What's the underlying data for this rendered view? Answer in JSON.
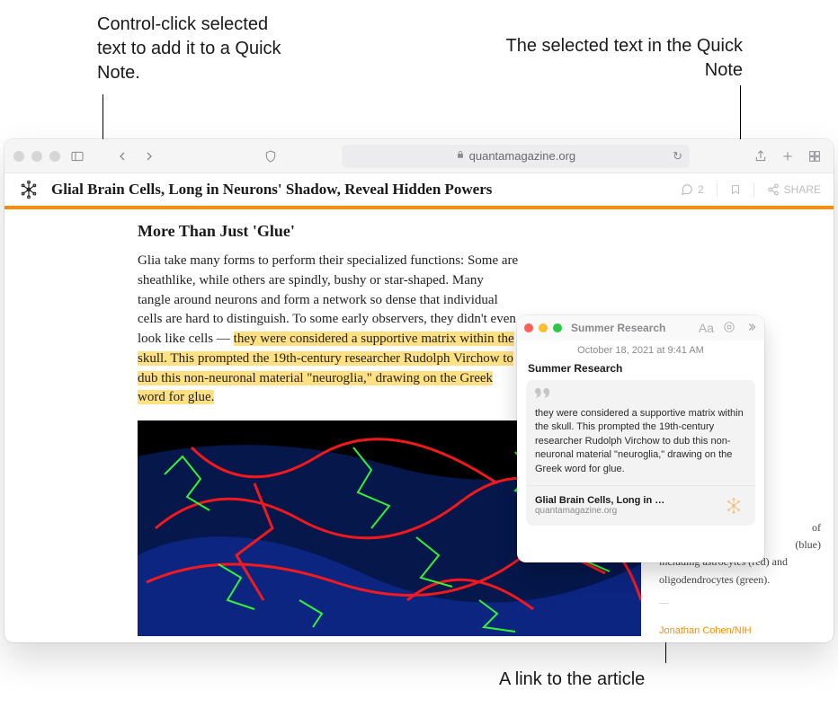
{
  "callouts": {
    "c1": "Control-click selected text to add it to a Quick Note.",
    "c2": "The selected text in the Quick Note",
    "c3": "A link to the article"
  },
  "toolbar": {
    "url_display": "quantamagazine.org"
  },
  "article": {
    "headline": "Glial Brain Cells, Long in Neurons' Shadow, Reveal Hidden Powers",
    "comment_count": "2",
    "share_label": "SHARE",
    "section_title": "More Than Just 'Glue'",
    "para_lead": "Glia take many forms to perform their specialized functions: Some are sheathlike, while others are spindly, bushy or star-shaped. Many tangle around neurons and form a network so dense that individual cells are hard to distinguish. To some early observers, they didn't even look like cells — ",
    "para_hl": "they were considered a supportive matrix within the skull. This prompted the 19th-century researcher Rudolph Virchow to dub this non-neuronal material \"neuroglia,\" drawing on the Greek word for glue.",
    "caption_suffix": "of (blue) including astrocytes (red) and oligodendrocytes (green).",
    "caption_line1": "of",
    "caption_line2": "(blue)",
    "caption_line3": "including astrocytes (red) and oligodendrocytes (green).",
    "credit": "Jonathan Cohen/NIH"
  },
  "quicknote": {
    "window_title": "Summer Research",
    "timestamp": "October 18, 2021 at 9:41 AM",
    "note_title": "Summer Research",
    "quote_text": "they were considered a supportive matrix within the skull. This prompted the 19th-century researcher Rudolph Virchow to dub this non-neuronal material \"neuroglia,\" drawing on the Greek word for glue.",
    "link_title": "Glial Brain Cells, Long in …",
    "link_url": "quantamagazine.org"
  }
}
